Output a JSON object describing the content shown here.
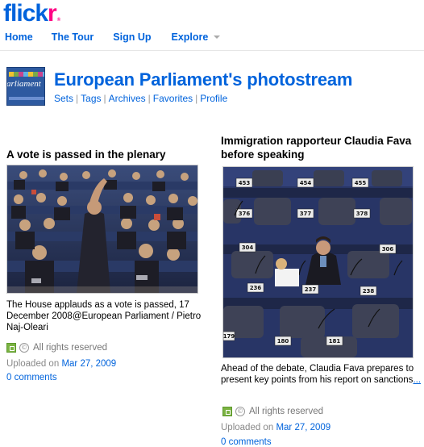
{
  "logo": {
    "part1": "flick",
    "part2": "r",
    "mark": "®"
  },
  "nav": {
    "home": "Home",
    "tour": "The Tour",
    "signup": "Sign Up",
    "explore": "Explore"
  },
  "profile": {
    "avatar_text": "arliament",
    "title": "European Parliament's photostream",
    "links": [
      "Sets",
      "Tags",
      "Archives",
      "Favorites",
      "Profile"
    ]
  },
  "photos": [
    {
      "title": "A vote is passed in the plenary",
      "caption": "The House applauds as a vote is passed, 17 December 2008@European Parliament / Pietro Naj-Oleari",
      "rights": "All rights reserved",
      "uploaded_prefix": "Uploaded on",
      "uploaded_date": "Mar 27, 2009",
      "comments": "0 comments"
    },
    {
      "title": "Immigration rapporteur Claudia Fava before speaking",
      "caption": "Ahead of the debate, Claudia Fava prepares to present key points from his report on sanctions",
      "more": "...",
      "rights": "All rights reserved",
      "uploaded_prefix": "Uploaded on",
      "uploaded_date": "Mar 27, 2009",
      "comments": "0 comments",
      "seat_numbers": [
        "453",
        "454",
        "455",
        "376",
        "377",
        "378",
        "304",
        "306",
        "236",
        "237",
        "238",
        "179",
        "180",
        "181"
      ]
    }
  ]
}
